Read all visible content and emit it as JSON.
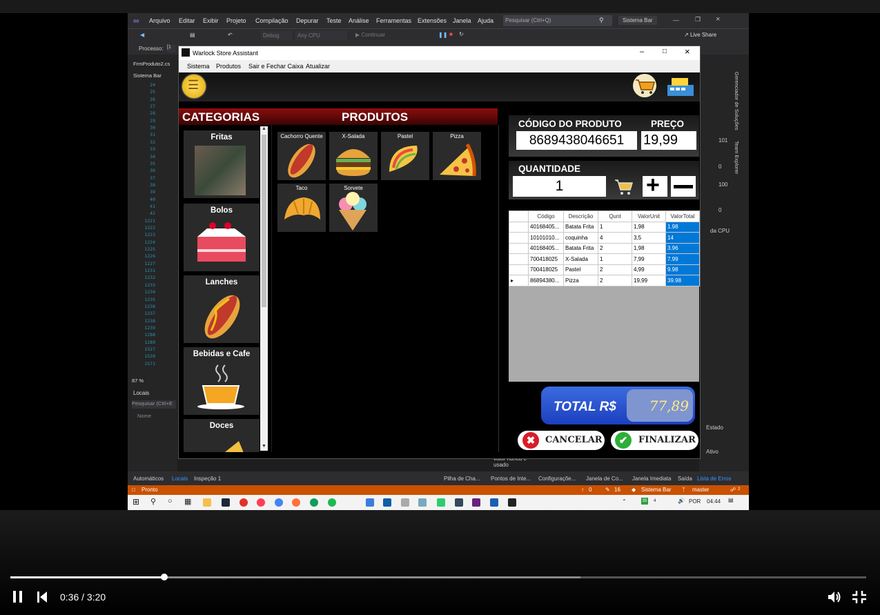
{
  "vs": {
    "menu": [
      "Arquivo",
      "Editar",
      "Exibir",
      "Projeto",
      "Compilação",
      "Depurar",
      "Teste",
      "Análise",
      "Ferramentas",
      "Extensões",
      "Janela",
      "Ajuda"
    ],
    "search_placeholder": "Pesquisar (Ctrl+Q)",
    "solution_name": "Sistema Bar",
    "live_share": "Live Share",
    "config_debug": "Debug",
    "config_cpu": "Any CPU",
    "continue": "Continuar",
    "process_label": "Processo:",
    "file_tab": "FrmProduto2.cs",
    "project_label": "Sistema Bar",
    "line_numbers": [
      "24",
      "25",
      "26",
      "27",
      "28",
      "29",
      "30",
      "31",
      "32",
      "33",
      "34",
      "35",
      "36",
      "37",
      "38",
      "39",
      "40",
      "41",
      "42",
      "1221",
      "1222",
      "1223",
      "1224",
      "1225",
      "1226",
      "1227",
      "1231",
      "1232",
      "1233",
      "1234",
      "1235",
      "1236",
      "1237",
      "1238",
      "1239",
      "1288",
      "1289",
      "1527",
      "1528",
      "1571"
    ],
    "zoom": "87 %",
    "locals_title": "Locais",
    "locals_search": "Pesquisar (Ctrl+E",
    "locals_name_col": "Nome",
    "right_panel": {
      "side_tabs": [
        "Gerenciador de Soluções",
        "Team Explorer"
      ],
      "values": [
        "101",
        "0",
        "100",
        "0"
      ],
      "cpu_label": "da CPU",
      "estado": "Estado",
      "ativo": "Ativo",
      "never_used": "valor nunca e usado"
    },
    "bottom_tabs": [
      "Automáticos",
      "Locais",
      "Inspeção 1",
      "Pilha de Cha...",
      "Pontos de Inte...",
      "Configuraçõe...",
      "Janela de Co...",
      "Janela Imediata",
      "Saída",
      "Lista de Erros"
    ],
    "status": {
      "left": "Pronto",
      "up": "0",
      "pencil": "16",
      "repo": "Sistema Bar",
      "branch": "master",
      "bell": "2"
    },
    "taskbar": {
      "lang": "POR",
      "time": "04:44",
      "badge": "35",
      "small": "4"
    }
  },
  "app": {
    "title": "Warlock Store Assistant",
    "menu": [
      "Sistema",
      "Produtos",
      "Sair e Fechar Caixa",
      "Atualizar"
    ],
    "categorias_header": "CATEGORIAS",
    "produtos_header": "PRODUTOS",
    "categories": [
      {
        "label": "Fritas",
        "icon": "fries-photo-icon"
      },
      {
        "label": "Bolos",
        "icon": "cake-icon"
      },
      {
        "label": "Lanches",
        "icon": "hotdog-icon"
      },
      {
        "label": "Bebidas e Cafe",
        "icon": "coffee-cup-icon"
      },
      {
        "label": "Doces",
        "icon": "sweets-icon"
      }
    ],
    "products": [
      {
        "label": "Cachorro Quente",
        "icon": "hotdog-icon"
      },
      {
        "label": "X-Salada",
        "icon": "burger-icon"
      },
      {
        "label": "Pastel",
        "icon": "taco-icon"
      },
      {
        "label": "Pizza",
        "icon": "pizza-icon"
      },
      {
        "label": "Taco",
        "icon": "croissant-icon"
      },
      {
        "label": "Sorvete",
        "icon": "ice-cream-icon"
      }
    ],
    "codigo_label": "CÓDIGO DO PRODUTO",
    "codigo_value": "8689438046651",
    "preco_label": "PREÇO",
    "preco_value": "19,99",
    "quantidade_label": "QUANTIDADE",
    "quantidade_value": "1",
    "grid": {
      "columns": [
        "Código",
        "Descrição",
        "Qunt",
        "ValorUnit",
        "ValorTotal"
      ],
      "rows": [
        [
          "40168405...",
          "Batata Frita",
          "1",
          "1,98",
          "1.98"
        ],
        [
          "10101010...",
          "coquinha",
          "4",
          "3,5",
          "14"
        ],
        [
          "40168405...",
          "Batata Frita",
          "2",
          "1,98",
          "3.96"
        ],
        [
          "700418025",
          "X-Salada",
          "1",
          "7,99",
          "7.99"
        ],
        [
          "700418025",
          "Pastel",
          "2",
          "4,99",
          "9.98"
        ],
        [
          "86894380...",
          "Pizza",
          "2",
          "19,99",
          "39.98"
        ]
      ]
    },
    "total_label": "TOTAL R$",
    "total_value": "77,89",
    "cancelar": "CANCELAR",
    "finalizar": "FINALIZAR"
  },
  "player": {
    "time": "0:36 / 3:20",
    "progress": 0.18,
    "buffered": 0.666
  }
}
